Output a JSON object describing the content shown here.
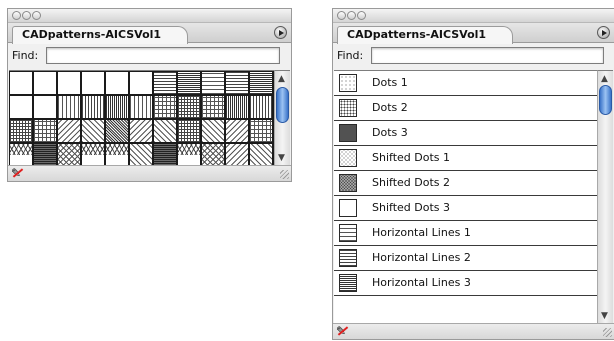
{
  "panels": [
    {
      "tab_label": "CADpatterns-AICSVol1",
      "find_label": "Find:",
      "find_value": "",
      "view": "grid",
      "swatches": [
        "p-blank",
        "p-blank",
        "p-blank",
        "p-blank",
        "p-blank",
        "p-blank",
        "p-hl2",
        "p-hl3",
        "p-hl1",
        "p-hl2",
        "p-hl3",
        "p-solidgray",
        "p-blank",
        "p-blank",
        "p-vl1",
        "p-vl2",
        "p-vl3",
        "p-vl1",
        "p-grid1",
        "p-grid2",
        "p-grid1",
        "p-vl3",
        "p-vl2",
        "p-vl1",
        "p-grid2",
        "p-grid1",
        "p-diag2",
        "p-diag1",
        "p-diag3",
        "p-diag2",
        "p-diag1",
        "p-grid2",
        "p-diag1",
        "p-diag2",
        "p-grid1",
        "p-hl2",
        "p-chev",
        "p-dense",
        "p-cross",
        "p-chev",
        "p-chev",
        "p-diag1",
        "p-dense",
        "p-chev",
        "p-cross",
        "p-diag2",
        "p-diag1",
        "p-diag3"
      ]
    },
    {
      "tab_label": "CADpatterns-AICSVol1",
      "find_label": "Find:",
      "find_value": "",
      "view": "list",
      "items": [
        {
          "label": "Dots 1",
          "pattern": "p-dots1"
        },
        {
          "label": "Dots 2",
          "pattern": "p-dots2"
        },
        {
          "label": "Dots 3",
          "pattern": "p-dots3"
        },
        {
          "label": "Shifted Dots 1",
          "pattern": "p-sdots1"
        },
        {
          "label": "Shifted Dots 2",
          "pattern": "p-sdots2"
        },
        {
          "label": "Shifted Dots 3",
          "pattern": "p-sdots3"
        },
        {
          "label": "Horizontal Lines 1",
          "pattern": "p-hl1"
        },
        {
          "label": "Horizontal Lines 2",
          "pattern": "p-hl2"
        },
        {
          "label": "Horizontal Lines 3",
          "pattern": "p-hl3"
        }
      ]
    }
  ],
  "icons": {
    "close": "circle",
    "minimize": "circle",
    "zoom": "circle",
    "panel_menu": "right-triangle-in-circle",
    "delete_swatch": "pen-with-red-slash",
    "resize": "diagonal-grip",
    "scroll_up": "▲",
    "scroll_down": "▼"
  },
  "colors": {
    "scroll_thumb": "#3a73c8",
    "delete_slash": "#e02020"
  }
}
